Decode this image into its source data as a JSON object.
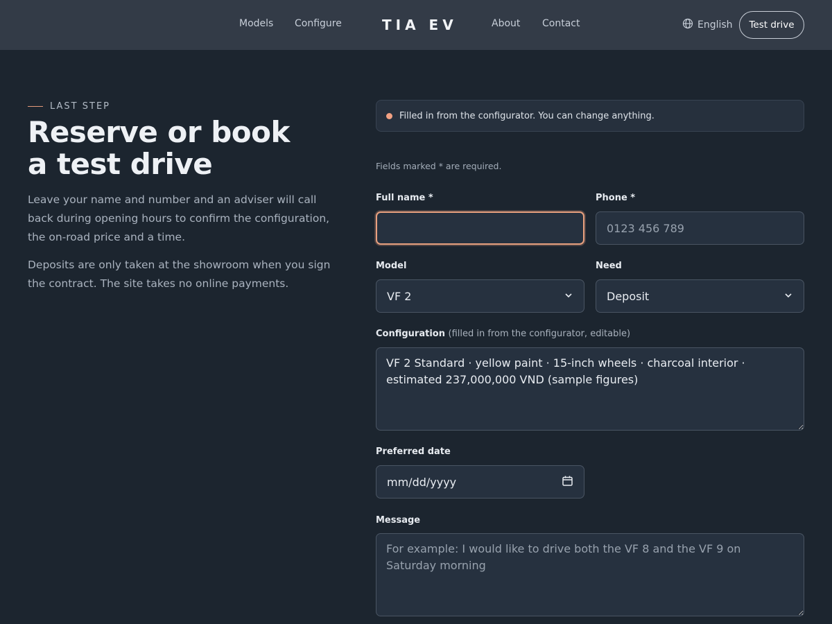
{
  "header": {
    "nav_left": [
      "Models",
      "Configure"
    ],
    "brand": "TIA EV",
    "nav_right": [
      "About",
      "Contact"
    ],
    "language": "English",
    "cta": "Test drive"
  },
  "intro": {
    "eyebrow": "LAST STEP",
    "title_line1": "Reserve or book",
    "title_line2": "a test drive",
    "lead": "Leave your name and number and an adviser will call back during opening hours to confirm the configuration, the on-road price and a time.",
    "note": "Deposits are only taken at the showroom when you sign the contract. The site takes no online payments."
  },
  "form": {
    "notice": "Filled in from the configurator. You can change anything.",
    "required_note": "Fields marked * are required.",
    "full_name": {
      "label": "Full name *",
      "value": "",
      "placeholder": ""
    },
    "phone": {
      "label": "Phone *",
      "value": "",
      "placeholder": "0123 456 789"
    },
    "model": {
      "label": "Model",
      "value": "VF 2"
    },
    "need": {
      "label": "Need",
      "value": "Deposit"
    },
    "configuration": {
      "label": "Configuration",
      "label_note": "(filled in from the configurator, editable)",
      "value": "VF 2 Standard · yellow paint · 15-inch wheels · charcoal interior · estimated 237,000,000 VND (sample figures)"
    },
    "preferred_date": {
      "label": "Preferred date",
      "value": "mm/dd/yyyy"
    },
    "message": {
      "label": "Message",
      "value": "",
      "placeholder": "For example: I would like to drive both the VF 8 and the VF 9 on Saturday morning"
    }
  },
  "colors": {
    "background": "#1c252f",
    "header": "#333b47",
    "accent": "#e9a17f",
    "field": "#26313f"
  },
  "icons": {
    "language": "globe-icon",
    "select": "chevron-down-icon",
    "date": "calendar-icon",
    "notice": "status-dot"
  }
}
